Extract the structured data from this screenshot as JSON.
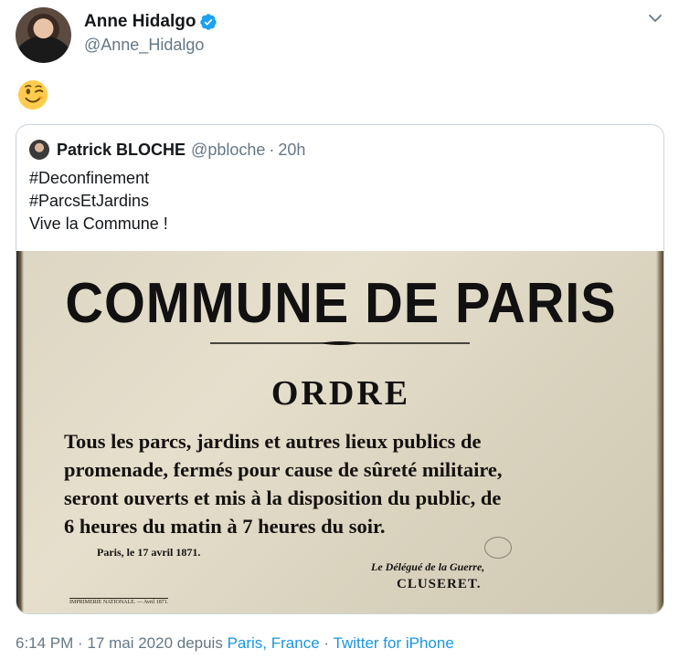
{
  "tweet": {
    "author": {
      "name": "Anne Hidalgo",
      "handle": "@Anne_Hidalgo",
      "verified_icon": "verified-badge-icon",
      "avatar_icon": "avatar"
    },
    "more_icon": "chevron-down-icon",
    "body_emoji": "winking-face-emoji"
  },
  "quote": {
    "author_name": "Patrick BLOCHE",
    "author_handle": "@pbloche",
    "separator": "·",
    "time": "20h",
    "text_lines": [
      "#Deconfinement",
      "#ParcsEtJardins",
      "Vive la Commune !"
    ]
  },
  "poster": {
    "title": "COMMUNE DE PARIS",
    "heading": "ORDRE",
    "body_lines": [
      "Tous les parcs, jardins et autres lieux publics de",
      "promenade, fermés pour cause de sûreté militaire,",
      "seront ouverts et mis à la disposition du public, de",
      "6 heures du matin à 7 heures du soir."
    ],
    "date": "Paris, le 17 avril 1871.",
    "delegate": "Le Délégué de la Guerre,",
    "signature": "CLUSERET.",
    "imprint": "IMPRIMERIE NATIONALE. — Avril 1871."
  },
  "meta": {
    "time": "6:14 PM",
    "sep1": "·",
    "date": "17 mai 2020 depuis",
    "location": "Paris, France",
    "sep2": "·",
    "source": "Twitter for iPhone"
  },
  "colors": {
    "link": "#1b95e0",
    "secondary_text": "#657786",
    "verified": "#1da1f2",
    "border": "#ccd6dd"
  }
}
